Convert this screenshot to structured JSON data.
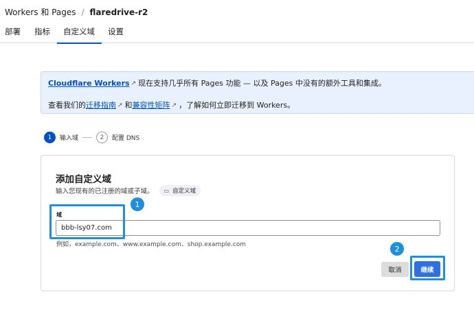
{
  "breadcrumb": {
    "parent": "Workers 和 Pages",
    "separator": "/",
    "current": "flaredrive-r2"
  },
  "tabs": [
    {
      "label": "部署",
      "active": false
    },
    {
      "label": "指标",
      "active": false
    },
    {
      "label": "自定义域",
      "active": true
    },
    {
      "label": "设置",
      "active": false
    }
  ],
  "banner": {
    "line1": {
      "link": "Cloudflare Workers",
      "text": "现在支持几乎所有 Pages 功能 — 以及 Pages 中没有的额外工具和集成。"
    },
    "line2": {
      "prefix": "查看我们的",
      "link1": "迁移指南",
      "joiner": "和",
      "link2": "兼容性矩阵",
      "suffix": "，了解如何立即迁移到 Workers。"
    },
    "external_icon": "external-link-icon",
    "external_glyph": "↗"
  },
  "steps": [
    {
      "number": "1",
      "label": "输入域",
      "active": true
    },
    {
      "number": "2",
      "label": "配置 DNS",
      "active": false
    }
  ],
  "form": {
    "title": "添加自定义域",
    "subtitle": "输入您现有的已注册的域或子域。",
    "docs_pill": "自定义域",
    "docs_icon": "book-icon",
    "docs_glyph": "▭",
    "field_label": "域",
    "field_value": "bbb-lsy07.com",
    "hint": "例如，example.com、www.example.com、shop.example.com",
    "cancel_label": "取消",
    "continue_label": "继续"
  },
  "annotations": {
    "marker1": "1",
    "marker2": "2"
  },
  "colors": {
    "accent": "#0051c3",
    "button_primary": "#2f6fe4",
    "highlight": "#1e8fde",
    "banner_bg": "#eaf1fe"
  }
}
